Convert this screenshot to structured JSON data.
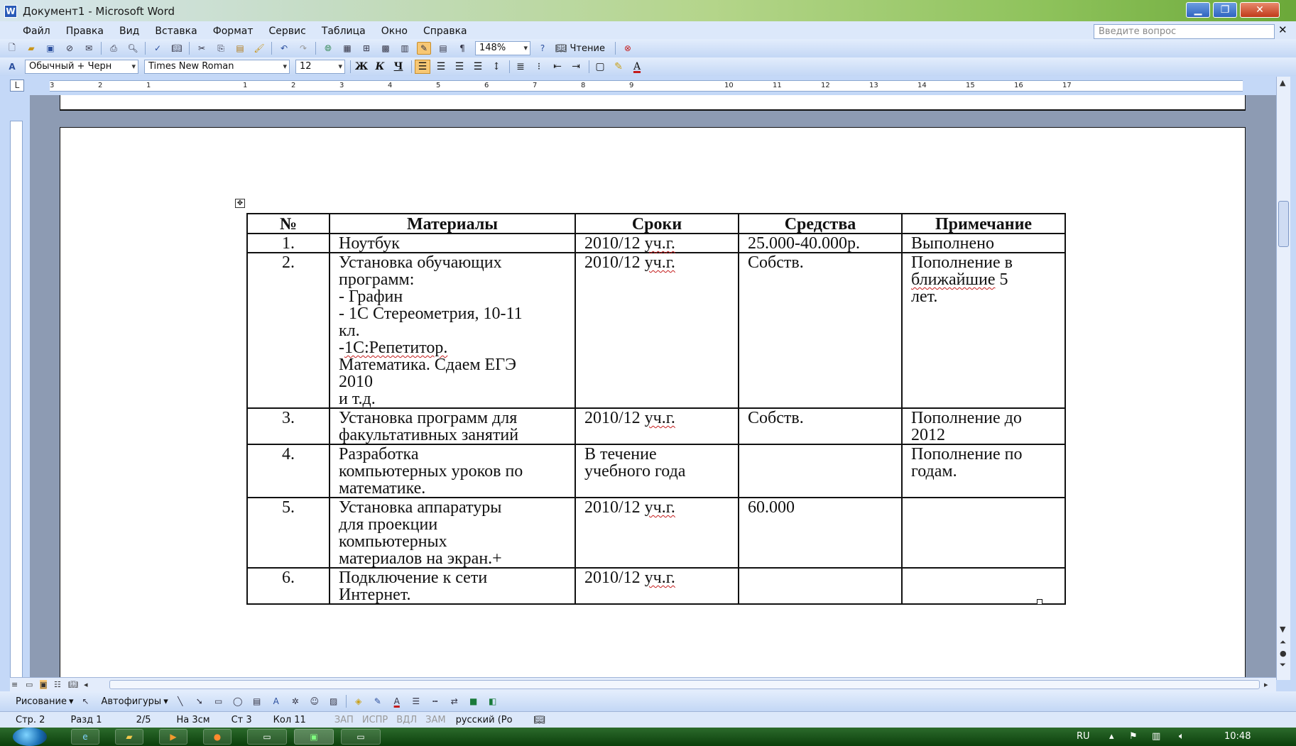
{
  "window": {
    "title": "Документ1 - Microsoft Word",
    "app_icon": "W"
  },
  "menu": [
    "Файл",
    "Правка",
    "Вид",
    "Вставка",
    "Формат",
    "Сервис",
    "Таблица",
    "Окно",
    "Справка"
  ],
  "help_box": {
    "placeholder": "Введите вопрос"
  },
  "toolbar1": {
    "zoom": "148%",
    "reading_label": "Чтение"
  },
  "toolbar2": {
    "style": "Обычный + Черн",
    "font": "Times New Roman",
    "size": "12",
    "bold": "Ж",
    "italic": "К",
    "underline": "Ч"
  },
  "ruler": {
    "corner": "L",
    "labels": [
      "3",
      "2",
      "1",
      "1",
      "2",
      "3",
      "4",
      "5",
      "6",
      "7",
      "8",
      "9",
      "10",
      "11",
      "12",
      "13",
      "14",
      "15",
      "16",
      "17"
    ]
  },
  "table": {
    "headers": [
      "№",
      "Материалы",
      "Сроки",
      "Средства",
      "Примечание"
    ],
    "rows": [
      {
        "num": "1.",
        "material": [
          "Ноутбук"
        ],
        "term": [
          "2010/12 уч.г."
        ],
        "funds": [
          "25.000-40.000р."
        ],
        "note": [
          "Выполнено"
        ]
      },
      {
        "num": "2.",
        "material": [
          "Установка обучающих",
          "программ:",
          "- Графин",
          "- 1С Стереометрия, 10-11",
          "кл.",
          "-1С:Репетитор.",
          "Математика. Сдаем ЕГЭ",
          "2010",
          "и т.д."
        ],
        "term": [
          " 2010/12 уч.г."
        ],
        "funds": [
          "Собств."
        ],
        "note": [
          "Пополнение в",
          "ближайшие 5",
          "лет."
        ]
      },
      {
        "num": "3.",
        "material": [
          "Установка программ для",
          "факультативных занятий"
        ],
        "term": [
          "2010/12 уч.г."
        ],
        "funds": [
          "Собств."
        ],
        "note": [
          "Пополнение до",
          "2012"
        ]
      },
      {
        "num": "4.",
        "material": [
          "Разработка",
          "компьютерных уроков по",
          "математике."
        ],
        "term": [
          "В течение",
          "учебного года"
        ],
        "funds": [],
        "note": [
          "Пополнение по",
          "годам."
        ]
      },
      {
        "num": "5.",
        "material": [
          "Установка аппаратуры",
          "для проекции",
          "компьютерных",
          "материалов на экран.+"
        ],
        "term": [
          "2010/12 уч.г."
        ],
        "funds": [
          "60.000"
        ],
        "note": []
      },
      {
        "num": "6.",
        "material": [
          "Подключение к сети",
          "Интернет."
        ],
        "term": [
          "2010/12 уч.г."
        ],
        "funds": [],
        "note": []
      }
    ]
  },
  "drawbar": {
    "draw_label": "Рисование",
    "autoshapes_label": "Автофигуры"
  },
  "statusbar": {
    "page": "Стр. 2",
    "section": "Разд 1",
    "pages": "2/5",
    "at": "На 3см",
    "line": "Ст 3",
    "col": "Кол 11",
    "rec": "ЗАП",
    "trk": "ИСПР",
    "ext": "ВДЛ",
    "ovr": "ЗАМ",
    "lang": "русский (Ро"
  },
  "taskbar": {
    "lang": "RU",
    "clock": "10:48"
  }
}
